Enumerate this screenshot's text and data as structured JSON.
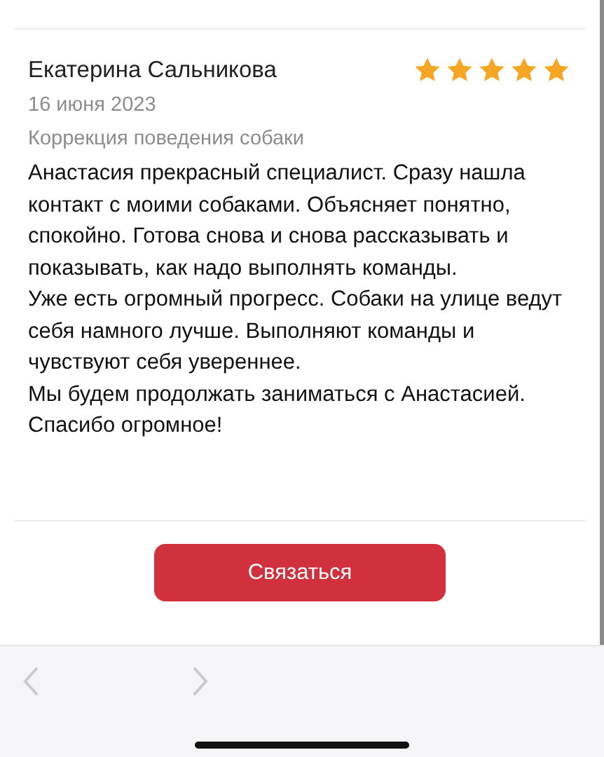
{
  "review": {
    "author": "Екатерина Сальникова",
    "stars": 5,
    "date": "16 июня 2023",
    "service": "Коррекция поведения собаки",
    "paragraphs": [
      "Анастасия прекрасный специалист. Сразу нашла контакт с моими собаками. Объясняет понятно, спокойно. Готова снова и снова рассказывать и показывать, как надо выполнять команды.",
      "Уже есть огромный прогресс. Собаки на улице ведут себя намного лучше. Выполняют команды и чувствуют себя увереннее.",
      "Мы будем продолжать заниматься с Анастасией.",
      "Спасибо огромное!"
    ]
  },
  "contact_button": {
    "label": "Связаться"
  },
  "browser_toolbar": {
    "back_disabled": true,
    "forward_disabled": true
  }
}
